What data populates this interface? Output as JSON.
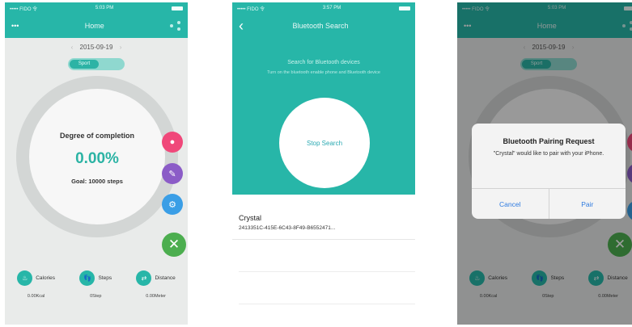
{
  "screen1": {
    "status": {
      "carrier": "••••• FIDO 令",
      "time": "5:03 PM"
    },
    "nav": {
      "left": "•••",
      "title": "Home"
    },
    "date": "2015-09-19",
    "toggle_label": "Sport",
    "ring": {
      "title": "Degree of completion",
      "percent": "0.00%",
      "goal": "Goal: 10000 steps"
    },
    "stats": [
      {
        "label": "Calories",
        "value": "0.00Kcal",
        "icon": "flame-icon"
      },
      {
        "label": "Steps",
        "value": "0Step",
        "icon": "footprint-icon"
      },
      {
        "label": "Distance",
        "value": "0.00Meter",
        "icon": "distance-icon"
      }
    ],
    "colors": {
      "accent": "#27b6a8",
      "pink": "#f0487a",
      "purple": "#8b5cc7",
      "blue": "#3a9ee6",
      "green": "#4cae4f"
    }
  },
  "screen2": {
    "status": {
      "carrier": "••••• FIDO 令",
      "time": "3:57 PM"
    },
    "nav": {
      "title": "Bluetooth Search"
    },
    "hint_title": "Search for Bluetooth devices",
    "hint_body": "Turn on the bluetooth enable phone and Bluetooth device",
    "stop_button": "Stop Search",
    "device": {
      "name": "Crystal",
      "id": "2413351C-415E-6C43-8F49-B6552471..."
    }
  },
  "screen3": {
    "status": {
      "carrier": "••••• FIDO 令",
      "time": "5:03 PM"
    },
    "nav": {
      "left": "•••",
      "title": "Home"
    },
    "date": "2015-09-19",
    "toggle_label": "Sport",
    "stats": [
      {
        "label": "Calories",
        "value": "0.00Kcal"
      },
      {
        "label": "Steps",
        "value": "0Step"
      },
      {
        "label": "Distance",
        "value": "0.00Meter"
      }
    ],
    "alert": {
      "title": "Bluetooth Pairing Request",
      "message": "\"Crystal\" would like to pair with your iPhone.",
      "cancel": "Cancel",
      "confirm": "Pair"
    }
  }
}
